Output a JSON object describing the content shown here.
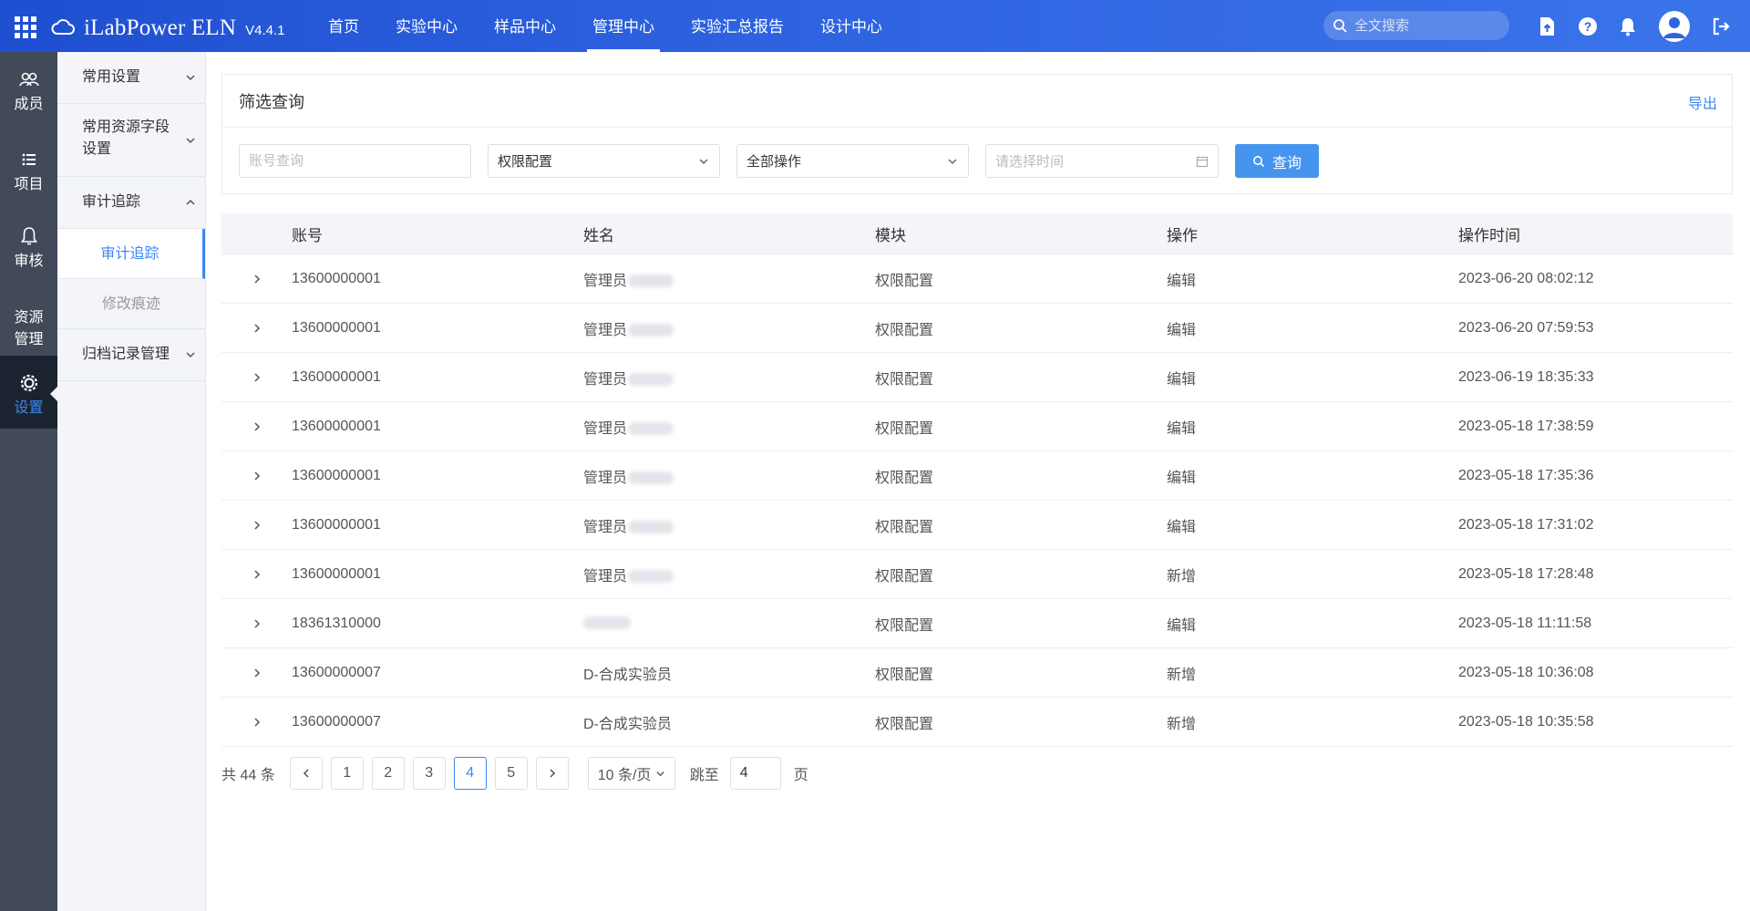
{
  "app": {
    "logo_name": "LabPower ELN",
    "logo_prefix": "i",
    "version": "V4.4.1"
  },
  "nav": [
    "首页",
    "实验中心",
    "样品中心",
    "管理中心",
    "实验汇总报告",
    "设计中心"
  ],
  "nav_active": "管理中心",
  "search": {
    "placeholder": "全文搜索"
  },
  "iconbar": [
    {
      "label": "成员",
      "icon": "members-icon"
    },
    {
      "label": "项目",
      "icon": "list-icon"
    },
    {
      "label": "审核",
      "icon": "bell-icon"
    },
    {
      "label": "资源管理",
      "icon": ""
    },
    {
      "label": "设置",
      "icon": "settings-icon",
      "active": true
    }
  ],
  "submenu": {
    "common_settings": "常用设置",
    "resource_fields": "常用资源字段设置",
    "audit_group": "审计追踪",
    "audit_item": "审计追踪",
    "trace_item": "修改痕迹",
    "archive": "归档记录管理"
  },
  "filter": {
    "title": "筛选查询",
    "export": "导出",
    "account_placeholder": "账号查询",
    "module_value": "权限配置",
    "operation_value": "全部操作",
    "time_placeholder": "请选择时间",
    "query_label": "查询"
  },
  "table": {
    "headers": [
      "账号",
      "姓名",
      "模块",
      "操作",
      "操作时间"
    ],
    "rows": [
      {
        "account": "13600000001",
        "name": "管理员",
        "module": "权限配置",
        "op": "编辑",
        "time": "2023-06-20 08:02:12"
      },
      {
        "account": "13600000001",
        "name": "管理员",
        "module": "权限配置",
        "op": "编辑",
        "time": "2023-06-20 07:59:53"
      },
      {
        "account": "13600000001",
        "name": "管理员",
        "module": "权限配置",
        "op": "编辑",
        "time": "2023-06-19 18:35:33"
      },
      {
        "account": "13600000001",
        "name": "管理员",
        "module": "权限配置",
        "op": "编辑",
        "time": "2023-05-18 17:38:59"
      },
      {
        "account": "13600000001",
        "name": "管理员",
        "module": "权限配置",
        "op": "编辑",
        "time": "2023-05-18 17:35:36"
      },
      {
        "account": "13600000001",
        "name": "管理员",
        "module": "权限配置",
        "op": "编辑",
        "time": "2023-05-18 17:31:02"
      },
      {
        "account": "13600000001",
        "name": "管理员",
        "module": "权限配置",
        "op": "新增",
        "time": "2023-05-18 17:28:48"
      },
      {
        "account": "18361310000",
        "name": "",
        "module": "权限配置",
        "op": "编辑",
        "time": "2023-05-18 11:11:58"
      },
      {
        "account": "13600000007",
        "name": "D-合成实验员",
        "module": "权限配置",
        "op": "新增",
        "time": "2023-05-18 10:36:08"
      },
      {
        "account": "13600000007",
        "name": "D-合成实验员",
        "module": "权限配置",
        "op": "新增",
        "time": "2023-05-18 10:35:58"
      }
    ]
  },
  "pagination": {
    "total_text": "共 44 条",
    "pages": [
      "1",
      "2",
      "3",
      "4",
      "5"
    ],
    "current": "4",
    "page_size": "10 条/页",
    "jump_label": "跳至",
    "jump_value": "4",
    "page_suffix": "页"
  },
  "colors": {
    "accent": "#3d88f0",
    "topbar": "#2e63e0",
    "sidebar": "#424959",
    "sidebar_active": "#1c2330"
  }
}
